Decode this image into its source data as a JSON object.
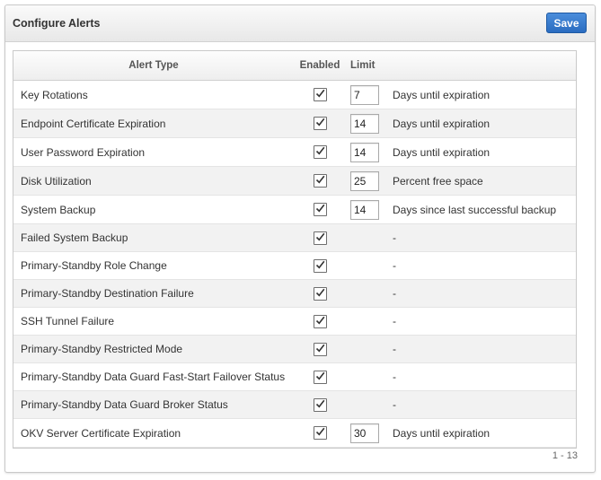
{
  "panel": {
    "title": "Configure Alerts",
    "save_label": "Save"
  },
  "table": {
    "headers": {
      "alert_type": "Alert Type",
      "enabled": "Enabled",
      "limit": "Limit"
    },
    "rows": [
      {
        "alert_type": "Key Rotations",
        "enabled": true,
        "limit": "7",
        "description": "Days until expiration"
      },
      {
        "alert_type": "Endpoint Certificate Expiration",
        "enabled": true,
        "limit": "14",
        "description": "Days until expiration"
      },
      {
        "alert_type": "User Password Expiration",
        "enabled": true,
        "limit": "14",
        "description": "Days until expiration"
      },
      {
        "alert_type": "Disk Utilization",
        "enabled": true,
        "limit": "25",
        "description": "Percent free space"
      },
      {
        "alert_type": "System Backup",
        "enabled": true,
        "limit": "14",
        "description": "Days since last successful backup"
      },
      {
        "alert_type": "Failed System Backup",
        "enabled": true,
        "limit": null,
        "description": "-"
      },
      {
        "alert_type": "Primary-Standby Role Change",
        "enabled": true,
        "limit": null,
        "description": "-"
      },
      {
        "alert_type": "Primary-Standby Destination Failure",
        "enabled": true,
        "limit": null,
        "description": "-"
      },
      {
        "alert_type": "SSH Tunnel Failure",
        "enabled": true,
        "limit": null,
        "description": "-"
      },
      {
        "alert_type": "Primary-Standby Restricted Mode",
        "enabled": true,
        "limit": null,
        "description": "-"
      },
      {
        "alert_type": "Primary-Standby Data Guard Fast-Start Failover Status",
        "enabled": true,
        "limit": null,
        "description": "-"
      },
      {
        "alert_type": "Primary-Standby Data Guard Broker Status",
        "enabled": true,
        "limit": null,
        "description": "-"
      },
      {
        "alert_type": "OKV Server Certificate Expiration",
        "enabled": true,
        "limit": "30",
        "description": "Days until expiration"
      }
    ]
  },
  "pagination": {
    "range": "1 - 13"
  },
  "colors": {
    "save_button": "#2f6fc2",
    "alt_row": "#f2f2f2",
    "header_bg": "#efefef"
  }
}
